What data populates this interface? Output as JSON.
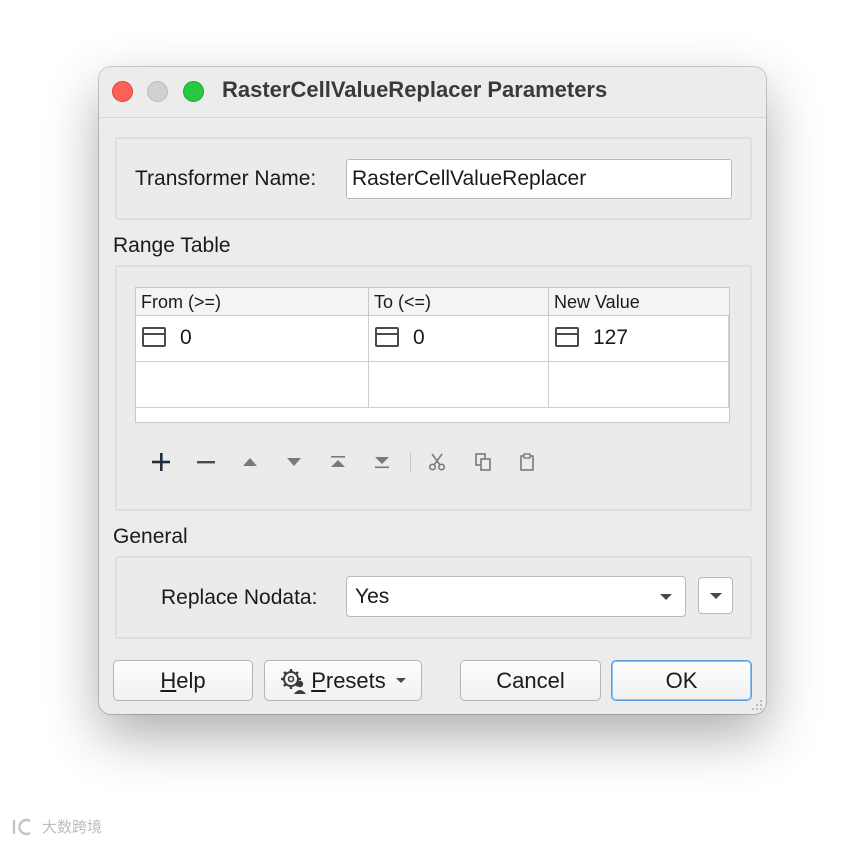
{
  "window": {
    "title": "RasterCellValueReplacer Parameters"
  },
  "transformer": {
    "label": "Transformer Name:",
    "value": "RasterCellValueReplacer"
  },
  "range_table": {
    "section_title": "Range Table",
    "columns": [
      "From (>=)",
      "To (<=)",
      "New Value"
    ],
    "rows": [
      [
        "0",
        "0",
        "127"
      ]
    ]
  },
  "toolbar": {
    "items": [
      "add-row",
      "remove-row",
      "move-up",
      "move-down",
      "move-to-top",
      "move-to-bottom",
      "cut",
      "copy",
      "paste"
    ]
  },
  "general": {
    "section_title": "General",
    "replace_nodata_label": "Replace Nodata:",
    "replace_nodata_value": "Yes"
  },
  "buttons": {
    "help_first": "H",
    "help_rest": "elp",
    "presets_first": "P",
    "presets_rest": "resets",
    "cancel": "Cancel",
    "ok": "OK"
  },
  "watermark": {
    "text": "大数跨境"
  },
  "colors": {
    "close": "#fe5f57",
    "minimize": "#d0d0d0",
    "maximize": "#28c840",
    "default_button_border": "#5a9fe0"
  }
}
